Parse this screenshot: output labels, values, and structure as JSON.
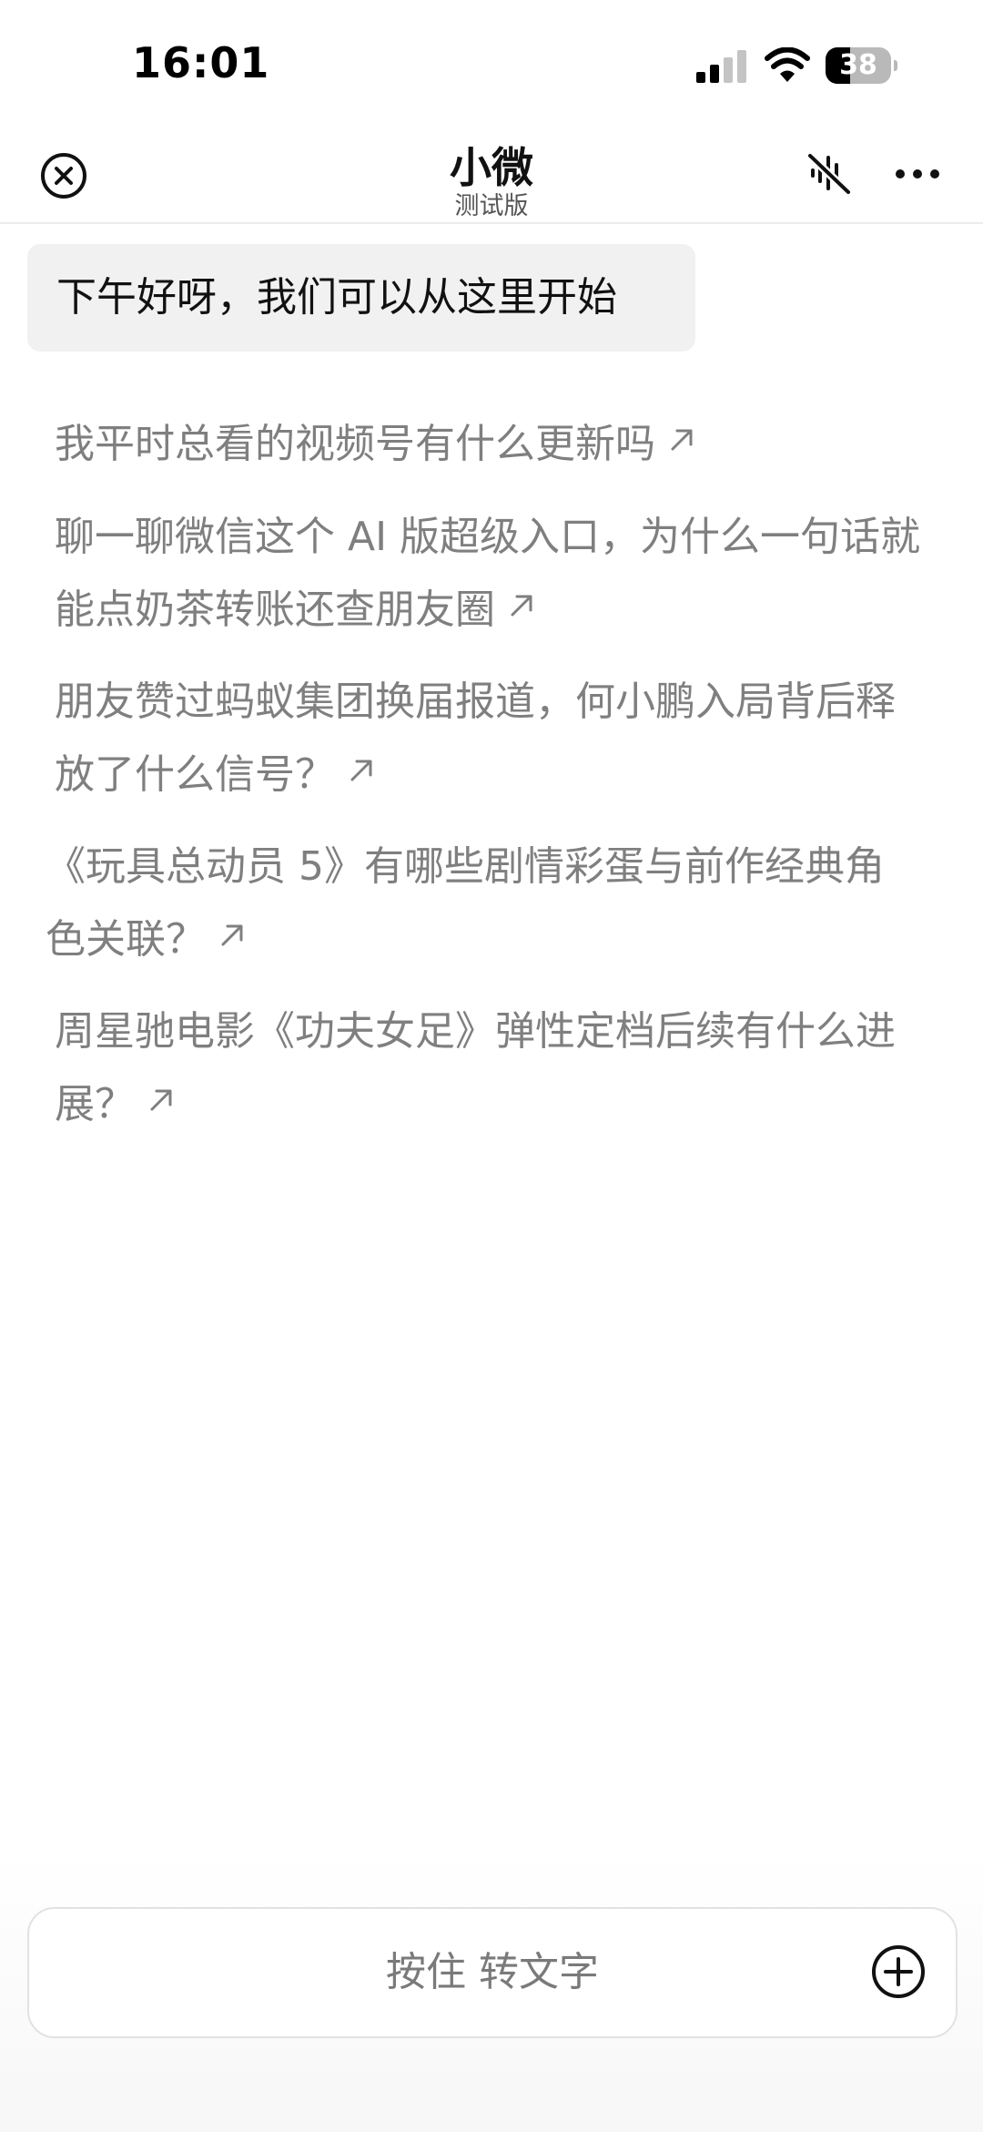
{
  "status_bar": {
    "time": "16:01",
    "battery_level": "38",
    "battery_fraction": 0.38,
    "icons": [
      "signal-icon",
      "wifi-icon",
      "battery-icon"
    ]
  },
  "nav": {
    "title": "小微",
    "subtitle": "测试版",
    "icons": [
      "close-circle-icon",
      "mute-icon",
      "more-icon"
    ]
  },
  "greeting": "下午好呀，我们可以从这里开始",
  "suggestions": [
    "我平时总看的视频号有什么更新吗",
    "聊一聊微信这个 AI 版超级入口，为什么一句话就能点奶茶转账还查朋友圈",
    "朋友赞过蚂蚁集团换届报道，何小鹏入局背后释放了什么信号？",
    "《玩具总动员 5》有哪些剧情彩蛋与前作经典角色关联？",
    "周星驰电影《功夫女足》弹性定档后续有什么进展？"
  ],
  "input": {
    "label": "按住 转文字",
    "plus_icon": "plus-circle-icon"
  },
  "colors": {
    "background": "#ffffff",
    "greeting_bubble": "#f1f1f1",
    "suggestion_text": "#7f7f7f",
    "primary_text": "#111111"
  }
}
